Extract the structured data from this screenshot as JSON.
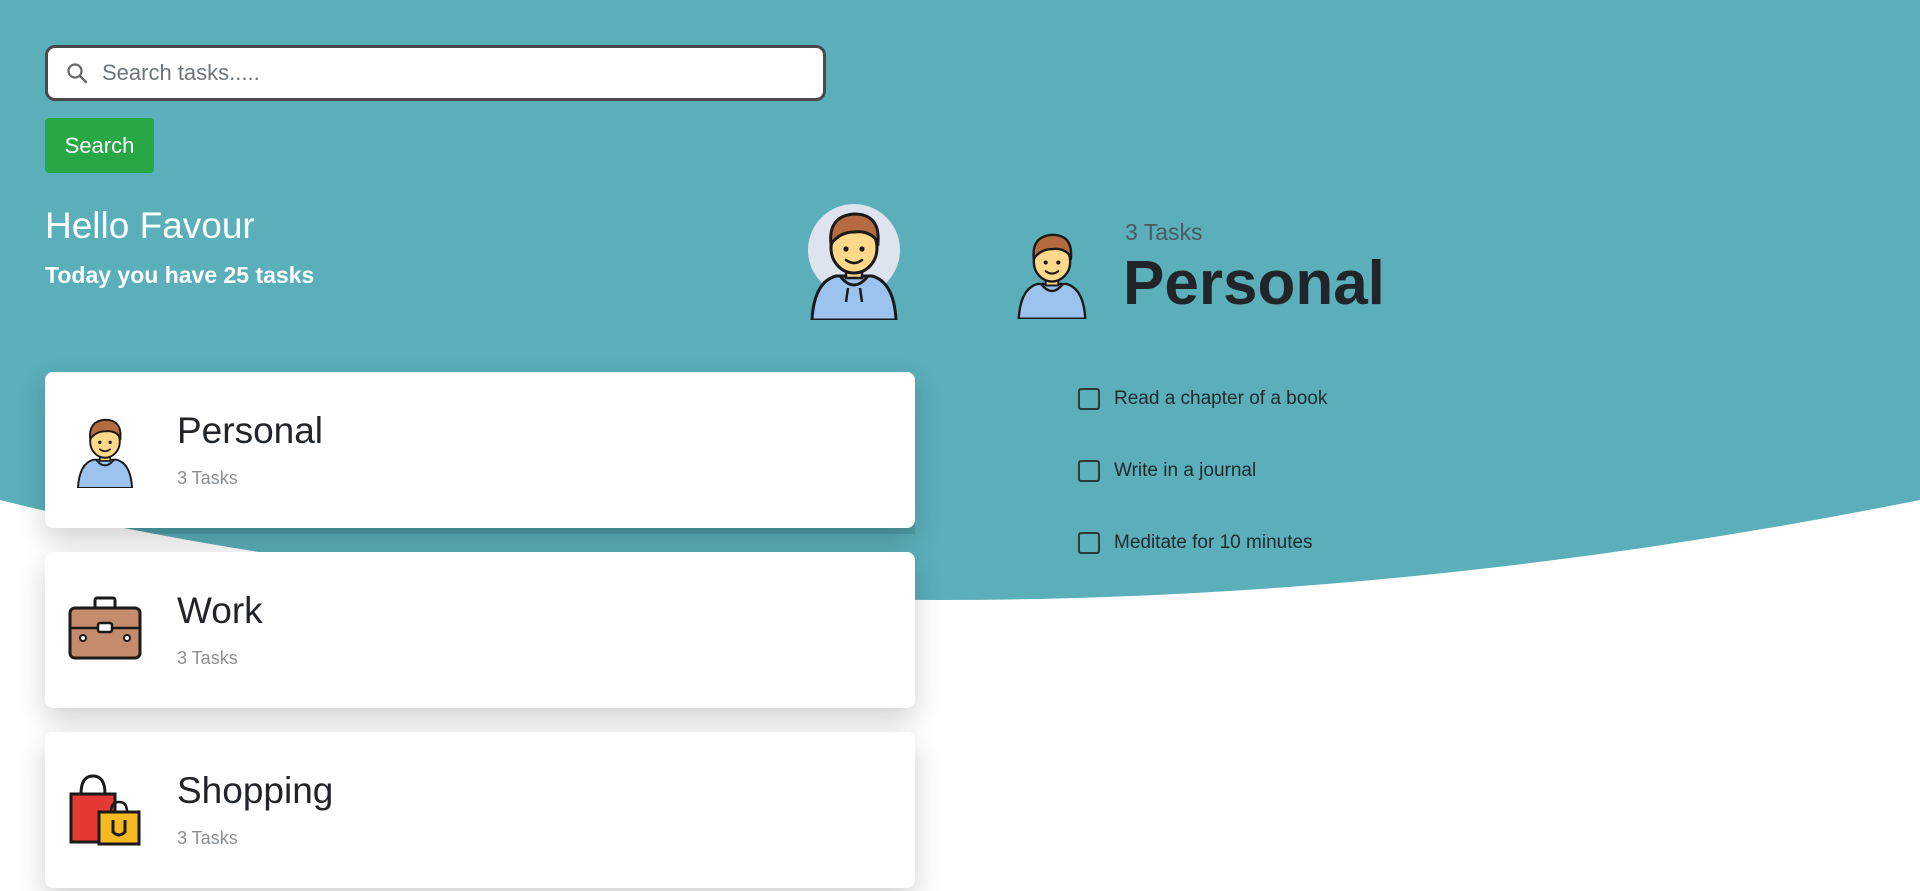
{
  "colors": {
    "header_teal": "#5aafba",
    "header_teal_shadow": "#4f9ea8",
    "search_button": "#28a745",
    "card_background": "#ffffff"
  },
  "search": {
    "placeholder": "Search tasks.....",
    "value": "",
    "button_label": "Search",
    "icon": "search-icon"
  },
  "greeting": {
    "title": "Hello Favour",
    "subtitle": "Today you have 25 tasks",
    "avatar_icon": "user-avatar-icon"
  },
  "categories": [
    {
      "name": "Personal",
      "count_label": "3 Tasks",
      "icon": "person-icon"
    },
    {
      "name": "Work",
      "count_label": "3 Tasks",
      "icon": "briefcase-icon"
    },
    {
      "name": "Shopping",
      "count_label": "3 Tasks",
      "icon": "shopping-bags-icon"
    }
  ],
  "detail": {
    "count_label": "3 Tasks",
    "title": "Personal",
    "icon": "person-icon",
    "tasks": [
      {
        "label": "Read a chapter of a book",
        "checked": false
      },
      {
        "label": "Write in a journal",
        "checked": false
      },
      {
        "label": "Meditate for 10 minutes",
        "checked": false
      }
    ]
  }
}
